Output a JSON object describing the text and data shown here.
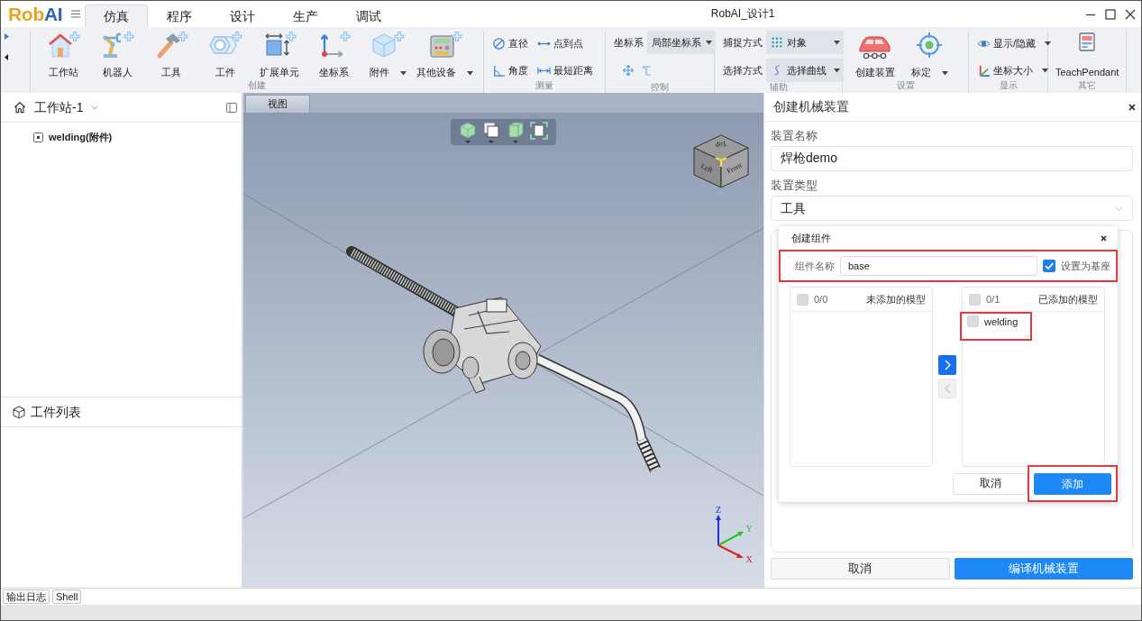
{
  "title_bar": {
    "logo": [
      {
        "text": "Rob",
        "color": "#e9a21c"
      },
      {
        "text": "AI",
        "color": "#2e63b8"
      }
    ],
    "title": "RobAI_设计1"
  },
  "tabs": [
    {
      "label": "仿真",
      "selected": true
    },
    {
      "label": "程序",
      "selected": false
    },
    {
      "label": "设计",
      "selected": false
    },
    {
      "label": "生产",
      "selected": false
    },
    {
      "label": "调试",
      "selected": false
    }
  ],
  "ribbon": [
    {
      "title": "创建",
      "kind": "large",
      "items": [
        {
          "label": "工作站",
          "dropdown": false
        },
        {
          "label": "机器人",
          "dropdown": false
        },
        {
          "label": "工具",
          "dropdown": false
        },
        {
          "label": "工件",
          "dropdown": false
        },
        {
          "label": "扩展单元",
          "dropdown": false
        },
        {
          "label": "坐标系",
          "dropdown": false
        },
        {
          "label": "附件",
          "dropdown": true
        },
        {
          "label": "其他设备",
          "dropdown": true
        }
      ]
    },
    {
      "title": "测量",
      "kind": "small",
      "items": [
        {
          "label": "直径",
          "dropdown": false
        },
        {
          "label": "点到点",
          "dropdown": false
        },
        {
          "label": "角度",
          "dropdown": false
        },
        {
          "label": "最短距离",
          "dropdown": false
        }
      ]
    },
    {
      "title": "控制",
      "kind": "combo",
      "rows": [
        {
          "kind": "combo",
          "label": "坐标系",
          "value": "局部坐标系"
        },
        {
          "kind": "icon-buttons"
        }
      ]
    },
    {
      "title": "辅助",
      "kind": "combo",
      "rows": [
        {
          "kind": "combo",
          "label": "捕捉方式",
          "value": "对象"
        },
        {
          "kind": "combo",
          "label": "选择方式",
          "value": "选择曲线"
        }
      ]
    },
    {
      "title": "设置",
      "kind": "large",
      "items": [
        {
          "label": "创建装置",
          "dropdown": false
        },
        {
          "label": "标定",
          "dropdown": true
        }
      ]
    },
    {
      "title": "显示",
      "kind": "small",
      "items": [
        {
          "label": "显示/隐藏",
          "dropdown": true
        },
        {
          "label": "坐标大小",
          "dropdown": true
        }
      ]
    },
    {
      "title": "其它",
      "kind": "large",
      "items": [
        {
          "label": "TeachPendant",
          "dropdown": false
        }
      ]
    }
  ],
  "workstation_panel": {
    "title": "工作站-1",
    "tree": [
      {
        "label": "welding(附件)"
      }
    ],
    "section_title": "工件列表"
  },
  "viewport": {
    "tab": "视图",
    "view_cube": [
      "Top",
      "Left",
      "Front"
    ],
    "axes": [
      {
        "label": "Z",
        "color": "#1f2fe0"
      },
      {
        "label": "Y",
        "color": "#2cc02c"
      },
      {
        "label": "X",
        "color": "#e02020"
      }
    ]
  },
  "mechanism_panel": {
    "title": "创建机械装置",
    "fields": [
      {
        "kind": "text",
        "label": "装置名称",
        "value": "焊枪demo"
      },
      {
        "kind": "select",
        "label": "装置类型",
        "value": "工具"
      }
    ],
    "buttons": [
      {
        "label": "取消",
        "primary": false
      },
      {
        "label": "编译机械装置",
        "primary": true
      }
    ]
  },
  "component_dialog": {
    "title": "创建组件",
    "name_row": {
      "highlighted": true,
      "label": "组件名称",
      "value": "base",
      "checkbox": {
        "label": "设置为基座",
        "checked": true
      }
    },
    "lists": [
      {
        "count": "0/0",
        "title": "未添加的模型",
        "all_checked": false
      },
      {
        "count": "0/1",
        "title": "已添加的模型",
        "all_checked": false,
        "items": [
          {
            "label": "welding",
            "checked": false,
            "highlighted": true
          }
        ]
      }
    ],
    "transfer_buttons": [
      {
        "disabled": false
      },
      {
        "disabled": true
      }
    ],
    "buttons": [
      {
        "label": "取消",
        "primary": false,
        "highlighted": false
      },
      {
        "label": "添加",
        "primary": true,
        "highlighted": true
      }
    ]
  },
  "output_tabs": [
    {
      "label": "输出日志"
    },
    {
      "label": "Shell"
    }
  ]
}
